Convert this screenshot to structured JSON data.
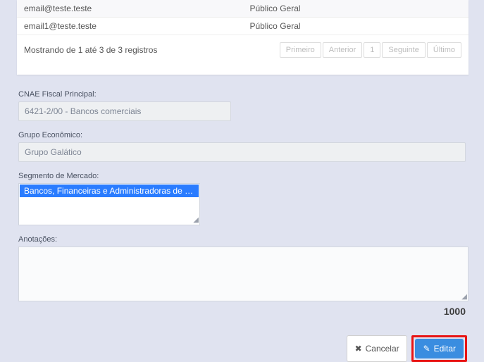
{
  "table": {
    "rows": [
      {
        "email": "email@teste.teste",
        "perfil": "Público Geral"
      },
      {
        "email": "email1@teste.teste",
        "perfil": "Público Geral"
      }
    ],
    "info": "Mostrando de 1 até 3 de 3 registros",
    "pager": {
      "primeiro": "Primeiro",
      "anterior": "Anterior",
      "page": "1",
      "seguinte": "Seguinte",
      "ultimo": "Último"
    }
  },
  "cnae": {
    "label": "CNAE Fiscal Principal:",
    "value": "6421-2/00 - Bancos comerciais"
  },
  "grupo": {
    "label": "Grupo Econômico:",
    "value": "Grupo Galático"
  },
  "segmento": {
    "label": "Segmento de Mercado:",
    "selected": "Bancos, Financeiras e Administradoras de Cartã"
  },
  "anotacoes": {
    "label": "Anotações:",
    "counter": "1000"
  },
  "buttons": {
    "cancelar": "Cancelar",
    "editar": "Editar"
  }
}
